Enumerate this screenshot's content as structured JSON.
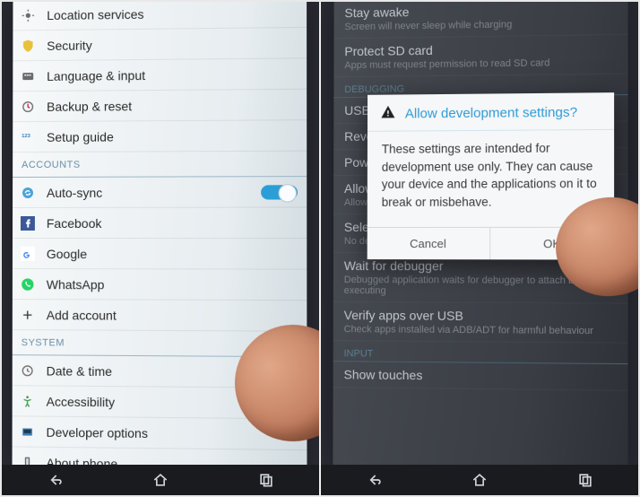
{
  "left": {
    "items": [
      {
        "icon": "location",
        "label": "Location services"
      },
      {
        "icon": "security",
        "label": "Security"
      },
      {
        "icon": "language",
        "label": "Language & input"
      },
      {
        "icon": "backup",
        "label": "Backup & reset"
      },
      {
        "icon": "setup",
        "label": "Setup guide"
      }
    ],
    "accounts_header": "ACCOUNTS",
    "accounts": [
      {
        "icon": "autosync",
        "label": "Auto-sync",
        "toggle": true
      },
      {
        "icon": "facebook",
        "label": "Facebook"
      },
      {
        "icon": "google",
        "label": "Google"
      },
      {
        "icon": "whatsapp",
        "label": "WhatsApp"
      },
      {
        "icon": "add",
        "label": "Add account"
      }
    ],
    "system_header": "SYSTEM",
    "system": [
      {
        "icon": "datetime",
        "label": "Date & time"
      },
      {
        "icon": "accessibility",
        "label": "Accessibility"
      },
      {
        "icon": "developer",
        "label": "Developer options"
      },
      {
        "icon": "about",
        "label": "About phone"
      }
    ]
  },
  "right": {
    "rows": [
      {
        "t1": "Stay awake",
        "t2": "Screen will never sleep while charging"
      },
      {
        "t1": "Protect SD card",
        "t2": "Apps must request permission to read SD card"
      }
    ],
    "debug_header": "DEBUGGING",
    "debug_rows": [
      {
        "t1": "USB debugging",
        "t2": ""
      },
      {
        "t1": "Revoke USB debugging authorisations",
        "t2": ""
      },
      {
        "t1": "Power menu bug reports",
        "t2": ""
      },
      {
        "t1": "Allow mock locations",
        "t2": "Allow mock locations"
      },
      {
        "t1": "Select debug app",
        "t2": "No debug application set"
      },
      {
        "t1": "Wait for debugger",
        "t2": "Debugged application waits for debugger to attach before executing"
      },
      {
        "t1": "Verify apps over USB",
        "t2": "Check apps installed via ADB/ADT for harmful behaviour"
      }
    ],
    "input_header": "INPUT",
    "input_rows": [
      {
        "t1": "Show touches",
        "t2": ""
      }
    ],
    "dialog": {
      "title": "Allow development settings?",
      "body": "These settings are intended for development use only. They can cause your device and the applications on it to break or misbehave.",
      "cancel": "Cancel",
      "ok": "OK"
    }
  }
}
